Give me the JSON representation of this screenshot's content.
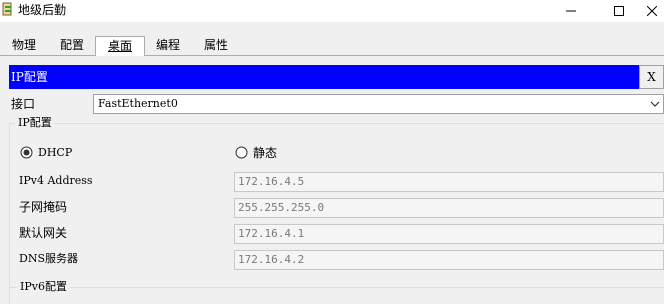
{
  "window": {
    "title": "地级后勤",
    "controls": {
      "minimize": "—",
      "maximize": "☐",
      "close": "✕"
    }
  },
  "tabs": [
    {
      "label": "物理"
    },
    {
      "label": "配置"
    },
    {
      "label": "桌面",
      "selected": true
    },
    {
      "label": "编程"
    },
    {
      "label": "属性"
    }
  ],
  "panel": {
    "header": "IP配置",
    "close_label": "X",
    "interface_label": "接口",
    "interface_value": "FastEthernet0",
    "ip_group_title": "IP配置",
    "dhcp_label": "DHCP",
    "static_label": "静态",
    "mode_selected": "DHCP",
    "fields": [
      {
        "label": "IPv4 Address",
        "value": "172.16.4.5"
      },
      {
        "label": "子网掩码",
        "value": "255.255.255.0"
      },
      {
        "label": "默认网关",
        "value": "172.16.4.1"
      },
      {
        "label": "DNS服务器",
        "value": "172.16.4.2"
      }
    ],
    "ipv6_title": "IPv6配置"
  },
  "colors": {
    "header_bg": "#0000ff",
    "header_text": "#ffffff",
    "window_bg": "#f0f0f0"
  }
}
